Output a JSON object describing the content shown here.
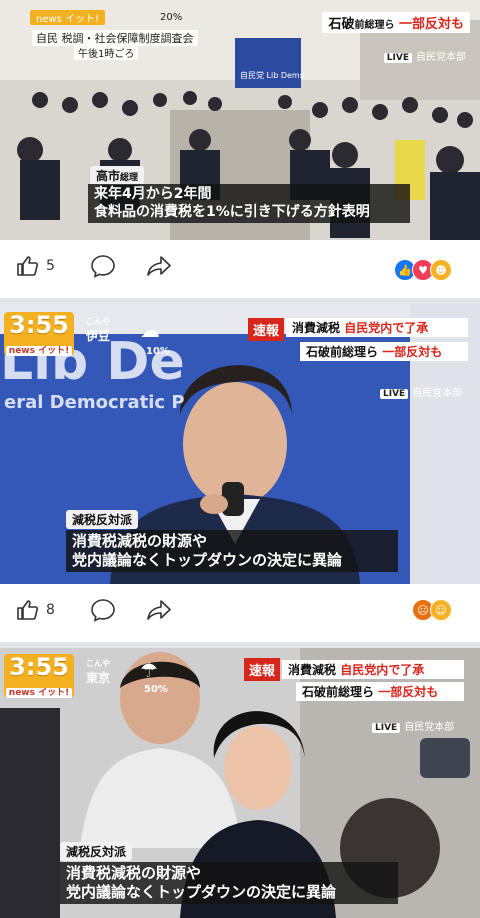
{
  "post1": {
    "top_pct": "20%",
    "brand_text": "news イット!",
    "top_right_headline": "石破前総理ら 一部反対も",
    "top_right_headline_prefix": "石破",
    "top_right_headline_mid": "前総理ら",
    "top_right_headline_red": "一部反対も",
    "meeting_label": "自民 税調・社会保障制度調査会",
    "time_label": "午後1時ごろ",
    "live_label": "LIVE",
    "location_label": "自民党本部",
    "name_tag": "高市",
    "name_tag_suffix": "総理",
    "subtitle_line1": "来年4月から2年間",
    "subtitle_line2": "食料品の消費税を1%に引き下げる方針表明",
    "backdrop_text": "自民党 Lib Dems",
    "like_count": "5"
  },
  "post2": {
    "clock": "3:55",
    "brand_text": "news イット!",
    "weather_location_small": "こんや",
    "weather_location": "伊豆",
    "weather_pct": "10%",
    "breaking_label": "速報",
    "headline_line1_black": "消費減税",
    "headline_line1_red": "自民党内で了承",
    "headline_line2_black": "石破前総理ら",
    "headline_line2_red": "一部反対も",
    "live_label": "LIVE",
    "location_label": "自民党本部",
    "backdrop_text": "Lib De",
    "backdrop_sub": "eral Democratic P",
    "name_tag": "減税反対派",
    "subtitle_line1": "消費税減税の財源や",
    "subtitle_line2": "党内議論なくトップダウンの決定に異論",
    "like_count": "8"
  },
  "post3": {
    "clock": "3:55",
    "brand_text": "news イット!",
    "weather_location_small": "こんや",
    "weather_location": "東京",
    "weather_pct": "50%",
    "breaking_label": "速報",
    "headline_line1_black": "消費減税",
    "headline_line1_red": "自民党内で了承",
    "headline_line2_black": "石破前総理ら",
    "headline_line2_red": "一部反対も",
    "live_label": "LIVE",
    "location_label": "自民党本部",
    "name_tag": "減税反対派",
    "subtitle_line1": "消費税減税の財源や",
    "subtitle_line2": "党内議論なくトップダウンの決定に異論"
  },
  "colors": {
    "accent_red": "#d7261c",
    "clock_orange": "#f3b021",
    "like_blue": "#1877f2",
    "love_red": "#f33e58",
    "angry_orange": "#e9710f"
  },
  "icons": [
    "like-icon",
    "comment-icon",
    "share-icon",
    "like-reaction-icon",
    "love-reaction-icon",
    "care-reaction-icon",
    "angry-reaction-icon",
    "haha-reaction-icon"
  ]
}
